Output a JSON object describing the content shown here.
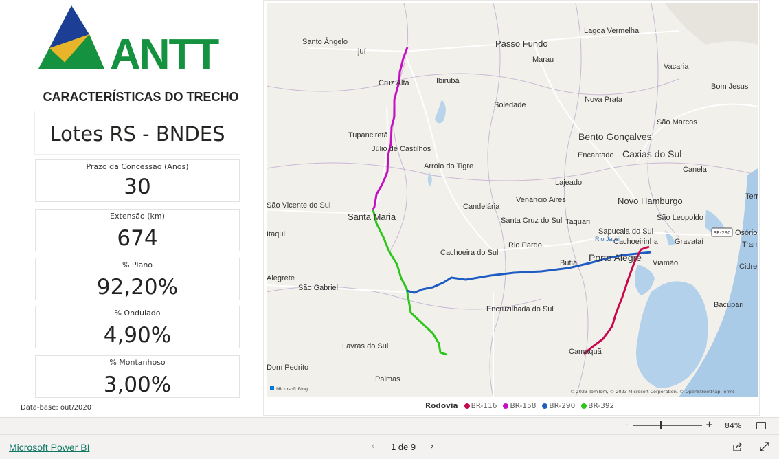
{
  "header": {
    "logo_text": "ANTT",
    "section_title": "CARACTERÍSTICAS DO TRECHO"
  },
  "cards": {
    "title": "Lotes RS - BNDES",
    "prazo": {
      "label": "Prazo da Concessão (Anos)",
      "value": "30"
    },
    "extensao": {
      "label": "Extensão (km)",
      "value": "674"
    },
    "plano": {
      "label": "% Plano",
      "value": "92,20%"
    },
    "ondulado": {
      "label": "% Ondulado",
      "value": "4,90%"
    },
    "montanhoso": {
      "label": "% Montanhoso",
      "value": "3,00%"
    }
  },
  "database_note": "Data-base: out/2020",
  "map": {
    "cities": [
      "Santo Ângelo",
      "Ijuí",
      "Passo Fundo",
      "Lagoa Vermelha",
      "Marau",
      "Vacaria",
      "Cruz Alta",
      "Ibirubá",
      "Bom Jesus",
      "Soledade",
      "Nova Prata",
      "Tupanciretã",
      "São Marcos",
      "Bento Gonçalves",
      "Júlio de Castilhos",
      "Encantado",
      "Caxias do Sul",
      "Arroio do Tigre",
      "Canela",
      "Lajeado",
      "São Vicente do Sul",
      "Santa Maria",
      "Candelária",
      "Venâncio Aires",
      "Novo Hamburgo",
      "São Leopoldo",
      "Santa Cruz do Sul",
      "Taquari",
      "Sapucaia do Sul",
      "Cachoeirinha",
      "Gravataí",
      "Rio Jacuí",
      "Rio Pardo",
      "Cachoeira do Sul",
      "Porto Alegre",
      "Viamão",
      "Butiá",
      "São Gabriel",
      "Encruzilhada do Sul",
      "Lavras do Sul",
      "Camaquã",
      "Bacupari",
      "Palmas",
      "Dom Pedrito",
      "Terra",
      "Osório",
      "Tramandaí",
      "Cidreira",
      "Itaqui",
      "Alegrete"
    ],
    "road_shield": "BR-290",
    "bing_label": "Microsoft Bing",
    "copyright": "© 2023 TomTom, © 2023 Microsoft Corporation, © OpenStreetMap  Terms",
    "legend_title": "Rodovia",
    "roads": [
      {
        "name": "BR-116",
        "color": "#c8094f"
      },
      {
        "name": "BR-158",
        "color": "#c60fc0"
      },
      {
        "name": "BR-290",
        "color": "#1e5cc4"
      },
      {
        "name": "BR-392",
        "color": "#2bc51b"
      }
    ]
  },
  "zoom": {
    "minus": "-",
    "plus": "+",
    "level": "84%"
  },
  "footer": {
    "brand": "Microsoft Power BI",
    "page_indicator": "1 de 9"
  }
}
